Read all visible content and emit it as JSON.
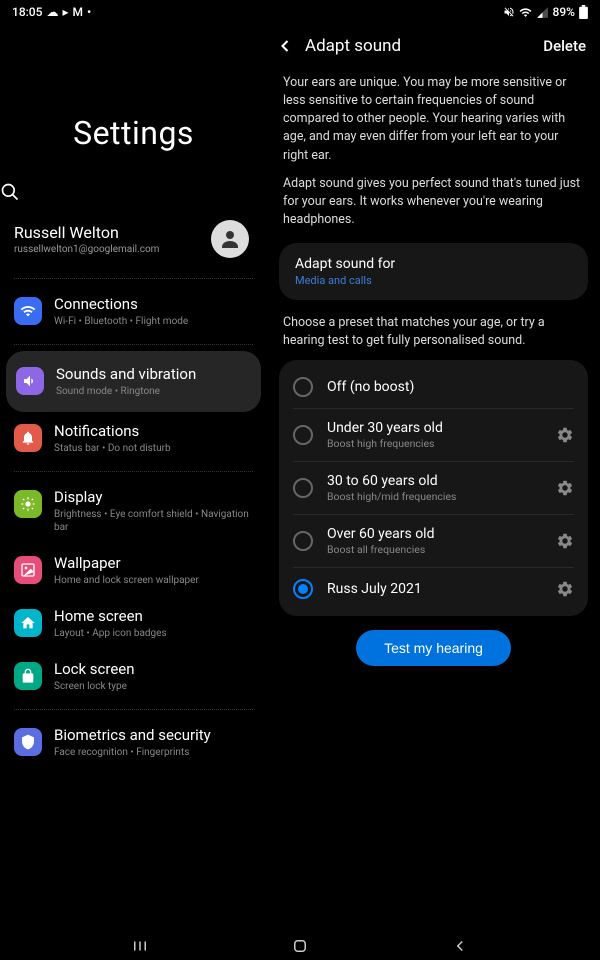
{
  "status": {
    "time": "18:05",
    "battery": "89%"
  },
  "left": {
    "title": "Settings",
    "account": {
      "name": "Russell Welton",
      "email": "russellwelton1@googlemail.com"
    },
    "items": {
      "connections": {
        "label": "Connections",
        "sub": "Wi-Fi • Bluetooth • Flight mode"
      },
      "sounds": {
        "label": "Sounds and vibration",
        "sub": "Sound mode • Ringtone"
      },
      "notifications": {
        "label": "Notifications",
        "sub": "Status bar • Do not disturb"
      },
      "display": {
        "label": "Display",
        "sub": "Brightness • Eye comfort shield • Navigation bar"
      },
      "wallpaper": {
        "label": "Wallpaper",
        "sub": "Home and lock screen wallpaper"
      },
      "homescreen": {
        "label": "Home screen",
        "sub": "Layout • App icon badges"
      },
      "lockscreen": {
        "label": "Lock screen",
        "sub": "Screen lock type"
      },
      "biometrics": {
        "label": "Biometrics and security",
        "sub": "Face recognition • Fingerprints"
      }
    }
  },
  "right": {
    "title": "Adapt sound",
    "delete": "Delete",
    "para1": "Your ears are unique. You may be more sensitive or less sensitive to certain frequencies of sound compared to other people. Your hearing varies with age, and may even differ from your left ear to your right ear.",
    "para2": "Adapt sound gives you perfect sound that's tuned just for your ears. It works whenever you're wearing headphones.",
    "adaptFor": {
      "title": "Adapt sound for",
      "value": "Media and calls"
    },
    "chooseText": "Choose a preset that matches your age, or try a hearing test to get fully personalised sound.",
    "presets": {
      "off": {
        "label": "Off (no boost)"
      },
      "under30": {
        "label": "Under 30 years old",
        "sub": "Boost high frequencies"
      },
      "thirty60": {
        "label": "30 to 60 years old",
        "sub": "Boost high/mid frequencies"
      },
      "over60": {
        "label": "Over 60 years old",
        "sub": "Boost all frequencies"
      },
      "custom": {
        "label": "Russ July 2021"
      }
    },
    "testBtn": "Test my hearing"
  }
}
